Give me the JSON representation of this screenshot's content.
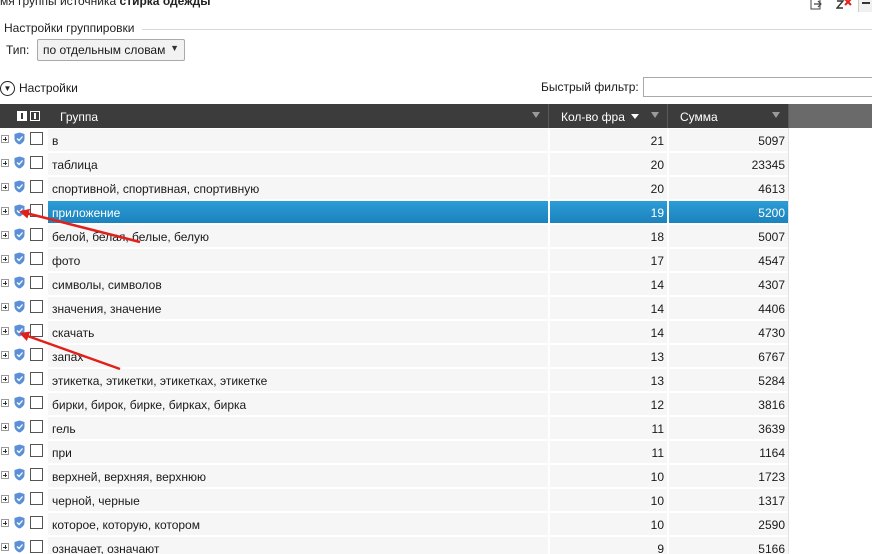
{
  "window": {
    "title_prefix": "мя группы источника",
    "title_bold": "стирка одежды"
  },
  "grouping": {
    "section_label": "Настройки группировки",
    "type_label": "Тип:",
    "type_value": "по отдельным словам"
  },
  "settings": {
    "toggle_label": "Настройки",
    "quick_filter_label": "Быстрый фильтр:",
    "quick_filter_value": ""
  },
  "grid": {
    "columns": {
      "group": "Группа",
      "count": "Кол-во фра",
      "sum": "Сумма"
    },
    "rows": [
      {
        "name": "в",
        "count": "21",
        "sum": "5097"
      },
      {
        "name": "таблица",
        "count": "20",
        "sum": "23345"
      },
      {
        "name": "спортивной, спортивная, спортивную",
        "count": "20",
        "sum": "4613"
      },
      {
        "name": "приложение",
        "count": "19",
        "sum": "5200",
        "selected": true
      },
      {
        "name": "белой, белая, белые, белую",
        "count": "18",
        "sum": "5007"
      },
      {
        "name": "фото",
        "count": "17",
        "sum": "4547"
      },
      {
        "name": "символы, символов",
        "count": "14",
        "sum": "4307"
      },
      {
        "name": "значения, значение",
        "count": "14",
        "sum": "4406"
      },
      {
        "name": "скачать",
        "count": "14",
        "sum": "4730"
      },
      {
        "name": "запах",
        "count": "13",
        "sum": "6767"
      },
      {
        "name": "этикетка, этикетки, этикетках, этикетке",
        "count": "13",
        "sum": "5284"
      },
      {
        "name": "бирки, бирок, бирке, бирках, бирка",
        "count": "12",
        "sum": "3816"
      },
      {
        "name": "гель",
        "count": "11",
        "sum": "3639"
      },
      {
        "name": "при",
        "count": "11",
        "sum": "1164"
      },
      {
        "name": "верхней, верхняя, верхнюю",
        "count": "10",
        "sum": "1723"
      },
      {
        "name": "черной, черные",
        "count": "10",
        "sum": "1317"
      },
      {
        "name": "которое, которую, котором",
        "count": "10",
        "sum": "2590"
      },
      {
        "name": "означает, означают",
        "count": "9",
        "sum": "5166"
      }
    ]
  },
  "colors": {
    "selection": "#1f8ac6",
    "header_bg": "#3c3c3c",
    "arrow": "#e0201b",
    "shield": "#5b8fd6"
  },
  "icons": {
    "export": "export-icon",
    "clear_filter": "clear-filter-icon",
    "shield": "shield-icon",
    "filter": "filter-icon",
    "expand": "expand-icon",
    "chevron": "chevron-down-icon"
  }
}
